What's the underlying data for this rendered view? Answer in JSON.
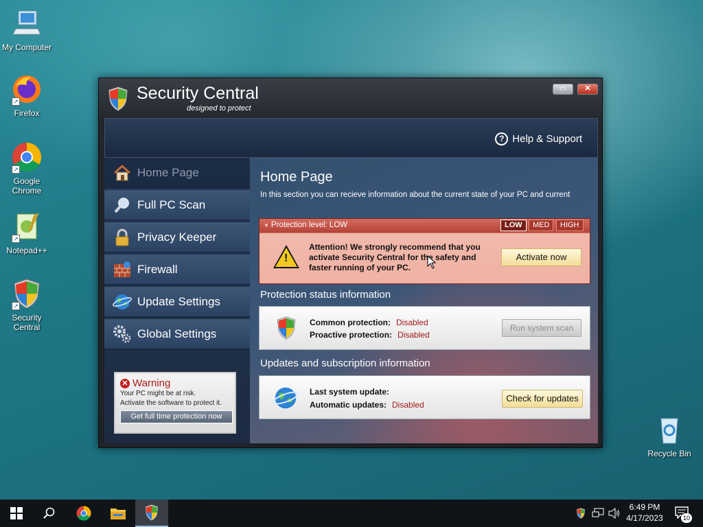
{
  "desktop": {
    "icons": [
      {
        "label": "My Computer",
        "icon": "computer-icon"
      },
      {
        "label": "Firefox",
        "icon": "firefox-icon"
      },
      {
        "label": "Google Chrome",
        "icon": "chrome-icon"
      },
      {
        "label": "Notepad++",
        "icon": "notepadpp-icon"
      },
      {
        "label": "Security Central",
        "icon": "shield-icon"
      },
      {
        "label": "Recycle Bin",
        "icon": "recycle-bin-icon"
      }
    ]
  },
  "window": {
    "title": "Security Central",
    "subtitle": "designed to protect",
    "help_label": "Help & Support",
    "help_glyph": "?",
    "minimize_glyph": "▭",
    "close_glyph": "✕"
  },
  "sidebar": {
    "items": [
      {
        "label": "Home Page",
        "icon": "house-icon"
      },
      {
        "label": "Full PC Scan",
        "icon": "magnifier-icon"
      },
      {
        "label": "Privacy Keeper",
        "icon": "padlock-icon"
      },
      {
        "label": "Firewall",
        "icon": "brick-wall-icon"
      },
      {
        "label": "Update Settings",
        "icon": "globe-icon"
      },
      {
        "label": "Global Settings",
        "icon": "gears-icon"
      }
    ],
    "warning": {
      "title": "Warning",
      "line1": "Your PC might be at risk.",
      "line2": "Activate the software to protect it.",
      "button": "Get full time protection now"
    }
  },
  "main": {
    "title": "Home Page",
    "description": "In this section you can recieve information about the current state of your PC and current",
    "protection": {
      "label": "Protection level: LOW",
      "levels": [
        "LOW",
        "MED",
        "HIGH"
      ],
      "message": "Attention! We strongly recommend that you activate Security Central for the safety and faster running of your PC.",
      "activate_button": "Activate now",
      "alert_mark": "!"
    },
    "status_section": {
      "title": "Protection status information",
      "common_label": "Common protection:",
      "common_value": "Disabled",
      "proactive_label": "Proactive protection:",
      "proactive_value": "Disabled",
      "scan_button": "Run system scan"
    },
    "updates_section": {
      "title": "Updates and subscription information",
      "last_update_label": "Last system update:",
      "auto_updates_label": "Automatic updates:",
      "auto_updates_value": "Disabled",
      "check_button": "Check for updates"
    }
  },
  "taskbar": {
    "time": "6:49 PM",
    "date": "4/17/2023",
    "notification_count": "10"
  },
  "colors": {
    "status_red": "#a01818",
    "accent_yellow": "#f3dd97",
    "warning_red": "#c41e1e"
  }
}
